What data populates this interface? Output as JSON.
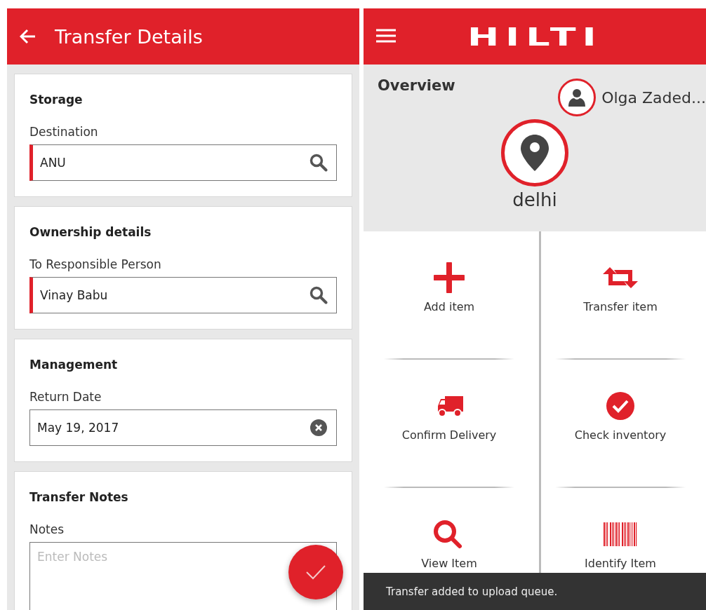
{
  "transfer_screen": {
    "title": "Transfer Details",
    "sections": [
      {
        "heading": "Storage",
        "field": {
          "label": "Destination",
          "value": "ANU",
          "kind": "search",
          "required": true
        }
      },
      {
        "heading": "Ownership details",
        "field": {
          "label": "To Responsible Person",
          "value": "Vinay Babu",
          "kind": "search",
          "required": true
        }
      },
      {
        "heading": "Management",
        "field": {
          "label": "Return Date",
          "value": "May 19, 2017",
          "kind": "clear",
          "required": false
        }
      },
      {
        "heading": "Transfer Notes",
        "field": {
          "label": "Notes",
          "placeholder": "Enter Notes",
          "kind": "notes",
          "required": false
        }
      }
    ]
  },
  "home_screen": {
    "logo": "HILTI",
    "overview": {
      "title": "Overview",
      "user": "Olga Zaded...",
      "location": "delhi"
    },
    "tiles": [
      {
        "label": "Add item",
        "kind": "add"
      },
      {
        "label": "Transfer item",
        "kind": "transfer"
      },
      {
        "label": "Confirm Delivery",
        "kind": "delivery"
      },
      {
        "label": "Check inventory",
        "kind": "check"
      },
      {
        "label": "View Item",
        "kind": "search"
      },
      {
        "label": "Identify Item",
        "kind": "barcode"
      }
    ],
    "snackbar": "Transfer added to upload queue."
  }
}
